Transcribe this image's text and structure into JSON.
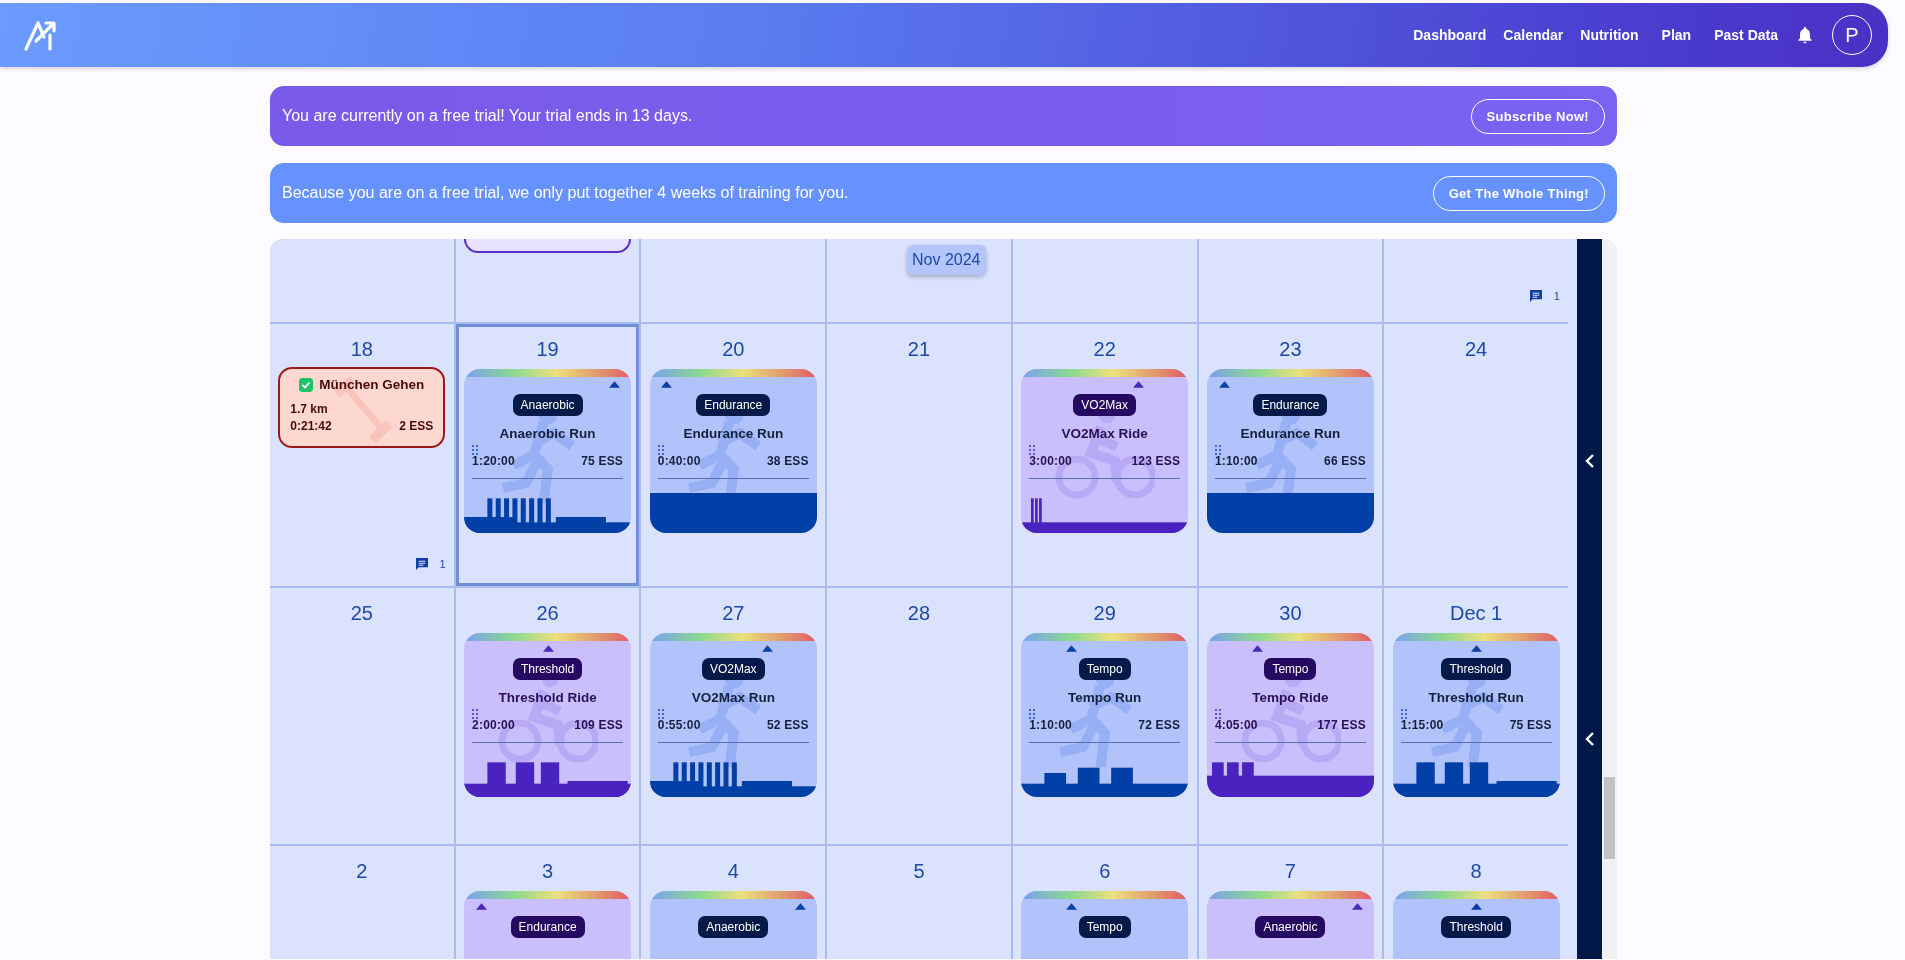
{
  "header": {
    "nav": [
      {
        "label": "Dashboard"
      },
      {
        "label": "Calendar"
      },
      {
        "label": "Nutrition"
      },
      {
        "label": "Plan"
      },
      {
        "label": "Past Data"
      }
    ],
    "avatar": "P"
  },
  "banners": [
    {
      "kind": "trial",
      "text": "You are currently on a free trial! Your trial ends in 13 days.",
      "button": "Subscribe Now!"
    },
    {
      "kind": "info",
      "text": "Because you are on a free trial, we only put together 4 weeks of training for you.",
      "button": "Get The Whole Thing!"
    }
  ],
  "calendar": {
    "month_label": "Nov 2024",
    "weeks": [
      {
        "days": [
          {
            "selected": false
          },
          {
            "selected": false,
            "workouts": [
              {
                "kind": "clipped"
              }
            ]
          },
          {
            "selected": false
          },
          {
            "selected": false
          },
          {
            "selected": false
          },
          {
            "selected": false
          },
          {
            "selected": false,
            "comments": "1"
          }
        ]
      },
      {
        "days": [
          {
            "date": "18",
            "selected": false,
            "comments": "1",
            "workouts": [
              {
                "kind": "strength",
                "completed": true,
                "title": "München Gehen",
                "distance": "1.7 km",
                "duration": "0:21:42",
                "ess": "2 ESS"
              }
            ]
          },
          {
            "date": "19",
            "selected": true,
            "workouts": [
              {
                "kind": "run",
                "level": 0.9,
                "tag": "Anaerobic",
                "title": "Anaerobic Run",
                "duration": "1:20:00",
                "ess": "75 ESS",
                "profile": {
                  "kind": "intervals"
                }
              }
            ]
          },
          {
            "date": "20",
            "selected": false,
            "workouts": [
              {
                "kind": "run",
                "level": 0.1,
                "tag": "Endurance",
                "title": "Endurance Run",
                "duration": "0:40:00",
                "ess": "38 ESS",
                "profile": {
                  "kind": "steady"
                }
              }
            ]
          },
          {
            "date": "21",
            "selected": false
          },
          {
            "date": "22",
            "selected": false,
            "workouts": [
              {
                "kind": "ride",
                "level": 0.7,
                "tag": "VO2Max",
                "title": "VO2Max Ride",
                "duration": "3:00:00",
                "ess": "123 ESS",
                "profile": {
                  "kind": "short-intervals"
                }
              }
            ]
          },
          {
            "date": "23",
            "selected": false,
            "workouts": [
              {
                "kind": "run",
                "level": 0.1,
                "tag": "Endurance",
                "title": "Endurance Run",
                "duration": "1:10:00",
                "ess": "66 ESS",
                "profile": {
                  "kind": "steady"
                }
              }
            ]
          },
          {
            "date": "24",
            "selected": false
          }
        ]
      },
      {
        "days": [
          {
            "date": "25",
            "selected": false
          },
          {
            "date": "26",
            "selected": false,
            "workouts": [
              {
                "kind": "ride",
                "level": 0.5,
                "tag": "Threshold",
                "title": "Threshold Ride",
                "duration": "2:00:00",
                "ess": "109 ESS",
                "profile": {
                  "kind": "blocks"
                }
              }
            ]
          },
          {
            "date": "27",
            "selected": false,
            "workouts": [
              {
                "kind": "run",
                "level": 0.7,
                "tag": "VO2Max",
                "title": "VO2Max Run",
                "duration": "0:55:00",
                "ess": "52 ESS",
                "profile": {
                  "kind": "intervals"
                }
              }
            ]
          },
          {
            "date": "28",
            "selected": false
          },
          {
            "date": "29",
            "selected": false,
            "workouts": [
              {
                "kind": "run",
                "level": 0.3,
                "tag": "Tempo",
                "title": "Tempo Run",
                "duration": "1:10:00",
                "ess": "72 ESS",
                "profile": {
                  "kind": "steps"
                }
              }
            ]
          },
          {
            "date": "30",
            "selected": false,
            "workouts": [
              {
                "kind": "ride",
                "level": 0.3,
                "tag": "Tempo",
                "title": "Tempo Ride",
                "duration": "4:05:00",
                "ess": "177 ESS",
                "profile": {
                  "kind": "short-blocks"
                }
              }
            ]
          },
          {
            "date": "Dec 1",
            "selected": false,
            "workouts": [
              {
                "kind": "run",
                "level": 0.5,
                "tag": "Threshold",
                "title": "Threshold Run",
                "duration": "1:15:00",
                "ess": "75 ESS",
                "profile": {
                  "kind": "blocks"
                }
              }
            ]
          }
        ]
      },
      {
        "days": [
          {
            "date": "2",
            "selected": false
          },
          {
            "date": "3",
            "selected": false,
            "workouts": [
              {
                "kind": "ride",
                "level": 0.1,
                "tag": "Endurance"
              }
            ]
          },
          {
            "date": "4",
            "selected": false,
            "workouts": [
              {
                "kind": "run",
                "level": 0.9,
                "tag": "Anaerobic"
              }
            ]
          },
          {
            "date": "5",
            "selected": false
          },
          {
            "date": "6",
            "selected": false,
            "workouts": [
              {
                "kind": "run",
                "level": 0.3,
                "tag": "Tempo"
              }
            ]
          },
          {
            "date": "7",
            "selected": false,
            "workouts": [
              {
                "kind": "ride",
                "level": 0.9,
                "tag": "Anaerobic"
              }
            ]
          },
          {
            "date": "8",
            "selected": false,
            "workouts": [
              {
                "kind": "run",
                "level": 0.5,
                "tag": "Threshold"
              }
            ]
          }
        ]
      }
    ]
  }
}
